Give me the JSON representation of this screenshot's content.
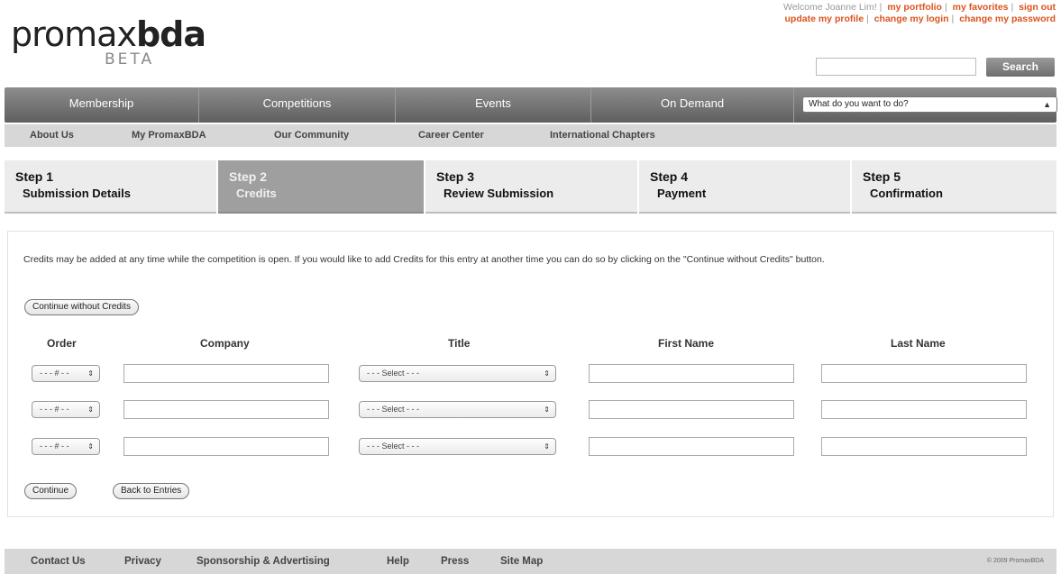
{
  "logo": {
    "main_light": "promax",
    "main_bold": "bda",
    "beta": "BETA"
  },
  "user_bar": {
    "welcome": "Welcome Joanne Lim!",
    "links_row1": [
      "my portfolio",
      "my favorites",
      "sign out"
    ],
    "links_row2": [
      "update my profile",
      "change my login",
      "change my password"
    ]
  },
  "search": {
    "value": "",
    "button": "Search"
  },
  "main_nav": {
    "items": [
      "Membership",
      "Competitions",
      "Events",
      "On Demand"
    ],
    "dropdown": "What do you want to do?"
  },
  "sub_nav": [
    "About Us",
    "My PromaxBDA",
    "Our Community",
    "Career Center",
    "International Chapters"
  ],
  "steps": [
    {
      "number": "Step 1",
      "title": "Submission Details"
    },
    {
      "number": "Step 2",
      "title": "Credits"
    },
    {
      "number": "Step 3",
      "title": "Review Submission"
    },
    {
      "number": "Step 4",
      "title": "Payment"
    },
    {
      "number": "Step 5",
      "title": "Confirmation"
    }
  ],
  "active_step": 2,
  "content": {
    "intro": "Credits may be added at any time while the competition is open. If you would like to add Credits for this entry at another time you can do so by clicking on the \"Continue without Credits\" button.",
    "continue_without": "Continue without Credits",
    "columns": [
      "Order",
      "Company",
      "Title",
      "First Name",
      "Last Name"
    ],
    "rows": [
      {
        "order": "- - - # - -",
        "company": "",
        "title": "- - - Select - - -",
        "first_name": "",
        "last_name": ""
      },
      {
        "order": "- - - # - -",
        "company": "",
        "title": "- - - Select - - -",
        "first_name": "",
        "last_name": ""
      },
      {
        "order": "- - - # - -",
        "company": "",
        "title": "- - - Select - - -",
        "first_name": "",
        "last_name": ""
      }
    ],
    "continue": "Continue",
    "back": "Back to Entries"
  },
  "footer": {
    "links": [
      "Contact Us",
      "Privacy",
      "Sponsorship & Advertising",
      "Help",
      "Press",
      "Site Map"
    ],
    "copyright": "© 2009 PromaxBDA"
  },
  "colors": {
    "link_orange": "#d9541e",
    "nav_gray": "#6e6e6e",
    "active_step": "#9f9f9f"
  }
}
